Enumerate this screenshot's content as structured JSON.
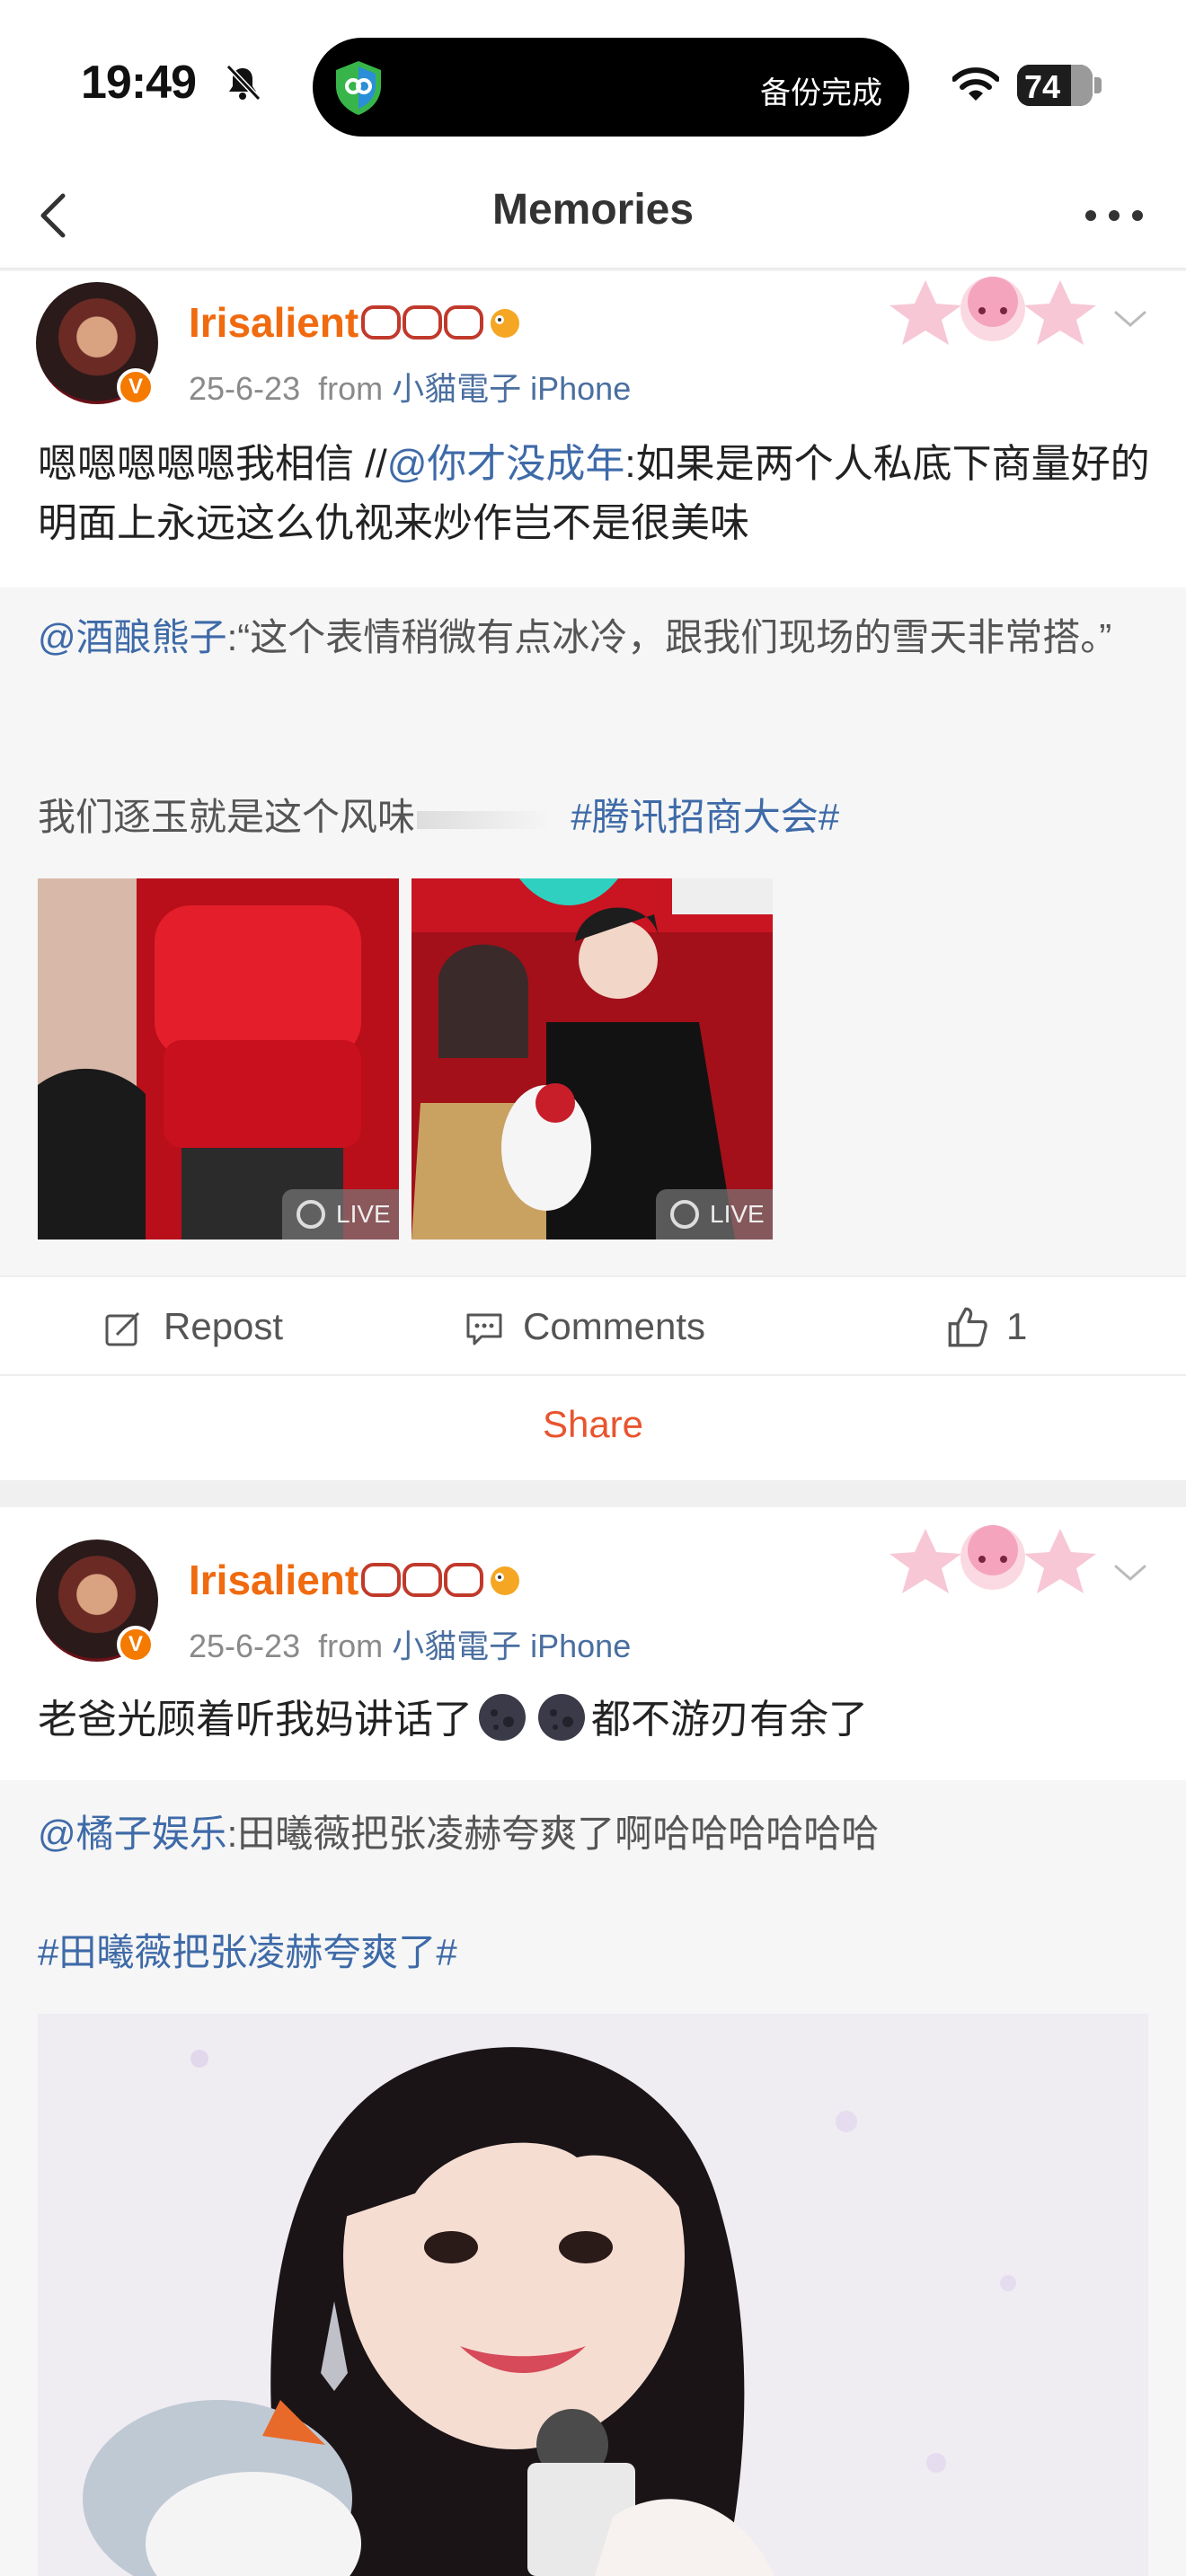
{
  "status_bar": {
    "time": "19:49",
    "island_text": "备份完成",
    "battery": "74",
    "battery_level": 0.74
  },
  "nav": {
    "title": "Memories"
  },
  "posts": [
    {
      "username": "Irisalient",
      "date": "25-6-23",
      "from_label": "from",
      "source": "小貓電子 iPhone",
      "verified_badge": "V",
      "text_prefix": "嗯嗯嗯嗯嗯我相信 //",
      "mention": "@你才没成年",
      "text_suffix": ":如果是两个人私底下商量好的明面上永远这么仇视来炒作岂不是很美味",
      "repost": {
        "mention": "@酒酿熊子",
        "text": ":“这个表情稍微有点冰冷，跟我们现场的雪天非常搭。”",
        "line2": "我们逐玉就是这个风味",
        "hashtag": "#腾讯招商大会#",
        "live_label_1": "LIVE",
        "live_label_2": "LIVE"
      },
      "actions": {
        "repost": "Repost",
        "comments": "Comments",
        "likes": "1",
        "share": "Share"
      }
    },
    {
      "username": "Irisalient",
      "date": "25-6-23",
      "from_label": "from",
      "source": "小貓電子 iPhone",
      "verified_badge": "V",
      "text_a": "老爸光顾着听我妈讲话了",
      "text_b": "都不游刃有余了",
      "repost": {
        "mention": "@橘子娱乐",
        "text": ":田曦薇把张凌赫夸爽了啊哈哈哈哈哈哈",
        "hashtag": "#田曦薇把张凌赫夸爽了#"
      }
    }
  ],
  "colors": {
    "username": "#f06a0f",
    "link": "#3e6aa8",
    "share": "#e8542e"
  }
}
